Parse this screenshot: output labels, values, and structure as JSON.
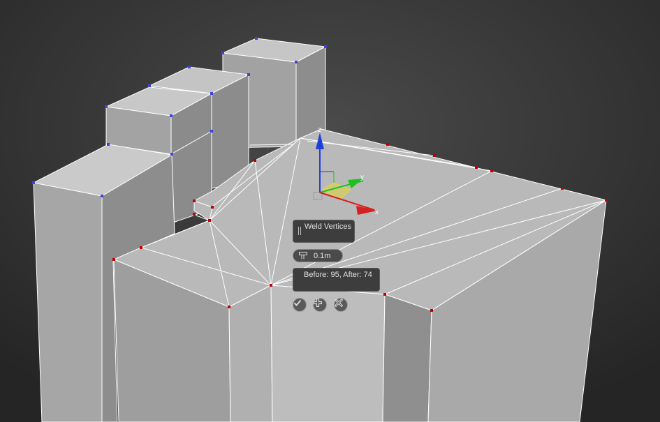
{
  "caddy": {
    "title": "Weld Vertices",
    "threshold_value": "0.1m",
    "result": "Before: 95, After: 74",
    "buttons": {
      "ok_icon": "checkmark-icon",
      "apply_icon": "plus-icon",
      "cancel_icon": "x-icon"
    }
  },
  "gizmo": {
    "axes": [
      "z",
      "y",
      "x"
    ],
    "colors": {
      "x": "#d42020",
      "y": "#20c020",
      "z": "#1e3fd8",
      "plane": "#e8e020"
    }
  },
  "colors": {
    "background": "#2b2b2b",
    "selected_vertex": "#c00000",
    "unselected_vertex": "#4040e0",
    "edge": "#ffffff"
  }
}
